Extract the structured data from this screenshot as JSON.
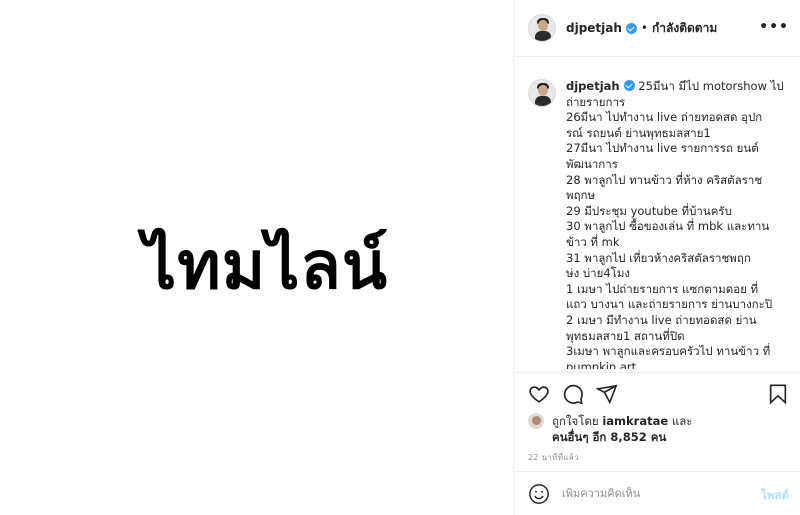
{
  "post_image": {
    "text": "ไทมไลน์"
  },
  "header": {
    "username": "djpetjah",
    "separator": "•",
    "follow_status": "กำลังติดตาม",
    "more": "•••"
  },
  "caption": {
    "username": "djpetjah",
    "lines": [
      "25มีนา มีไป motorshow ไป",
      "ถ่ายรายการ",
      "26มีนา ไปทำงาน live ถ่ายทอดสด อุปก",
      "รณ์ รถยนต์ ย่านพุทธมลสาย1",
      "27มีนา ไปทำงาน live รายการรถ ยนต์",
      "พัฒนาการ",
      "28 พาลูกไป ทานข้าว ที่ห้าง คริสตัลราช",
      "พฤกษ",
      "29 มีประชุม youtube ที่บ้านครับ",
      "30 พาลูกไป ซื้อของเล่น ที่ mbk และทาน",
      "ข้าว ที่ mk",
      "31 พาลูกไป เที่ยวห้างคริสตัลราชพฤก",
      "ษ่ง บ่าย4โมง",
      "1 เมษา ไปถ่ายรายการ แซกตามดอย ที่",
      "แถว บางนา และถ่ายรายการ ย่านบางกะปิ",
      "2 เมษา มีทำงาน live ถ่ายทอดสด ย่าน",
      "พุทธมลสาย1 สถานที่ปิด",
      "3เมษา พาลูกและครอบครัวไป ทานข้าว ที่",
      "pumpkin art"
    ]
  },
  "actions": {
    "like_icon": "heart-icon",
    "comment_icon": "comment-icon",
    "share_icon": "share-icon",
    "save_icon": "bookmark-icon"
  },
  "likes": {
    "prefix": "ถูกใจโดย",
    "liker": "iamkratae",
    "and": "และ",
    "others": "คนอื่นๆ อีก 8,852 คน"
  },
  "timestamp": "22 นาทีที่แล้ว",
  "comment": {
    "placeholder": "เพิ่มความคิดเห็น",
    "post_label": "โพสต์"
  },
  "colors": {
    "verified": "#3897f0",
    "post_button_disabled": "#b2dffc",
    "muted": "#8e8e8e"
  }
}
